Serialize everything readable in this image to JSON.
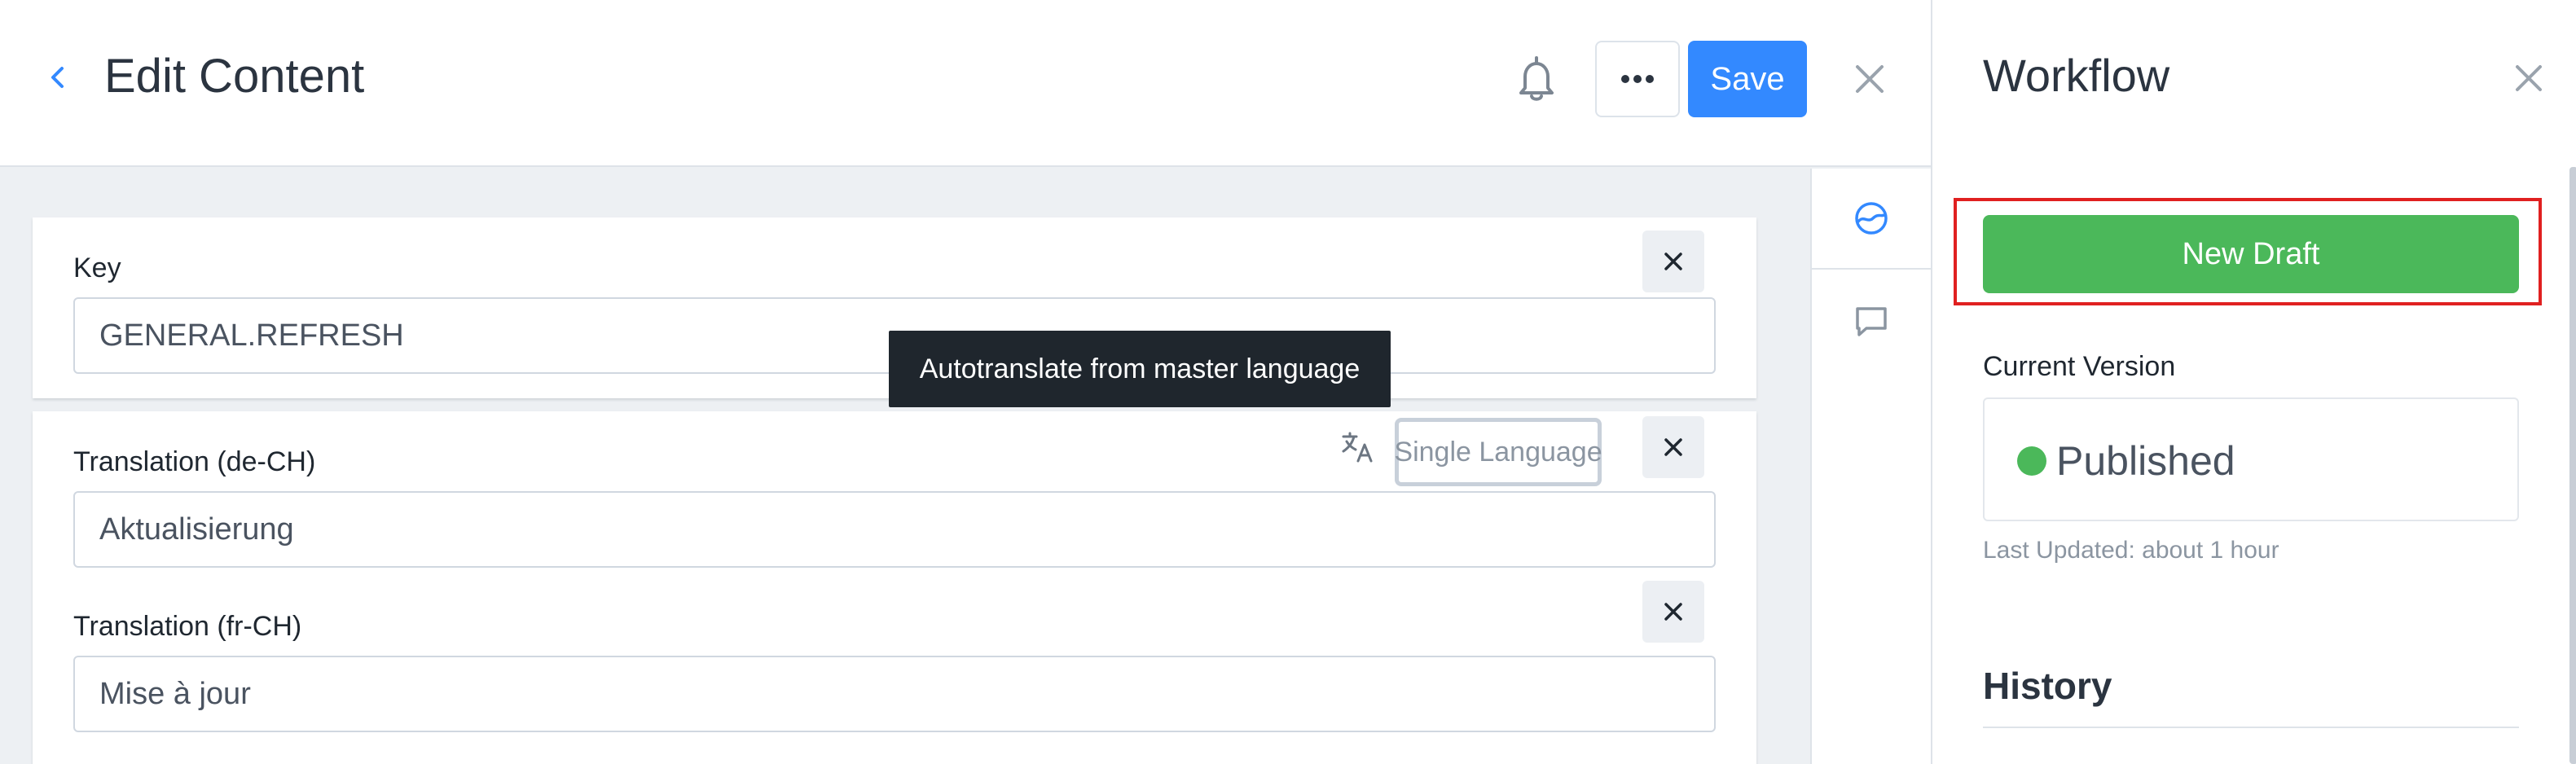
{
  "header": {
    "title": "Edit Content",
    "save_label": "Save",
    "icons": {
      "back": "chevron-left-icon",
      "bell": "bell-icon",
      "more": "more-horizontal-icon",
      "close": "close-icon"
    }
  },
  "fields": {
    "key": {
      "label": "Key",
      "value": "GENERAL.REFRESH"
    },
    "translations": [
      {
        "label": "Translation (de-CH)",
        "value": "Aktualisierung"
      },
      {
        "label": "Translation (fr-CH)",
        "value": "Mise à jour"
      }
    ],
    "single_language_label": "Single Language",
    "tooltip": "Autotranslate from master language"
  },
  "side_tabs": [
    {
      "icon": "history-icon",
      "active": true
    },
    {
      "icon": "comments-icon",
      "active": false
    }
  ],
  "workflow": {
    "title": "Workflow",
    "new_draft_label": "New Draft",
    "current_version_label": "Current Version",
    "status": "Published",
    "status_color": "#4bb85a",
    "last_updated": "Last Updated: about 1 hour",
    "history_title": "History"
  },
  "colors": {
    "accent": "#3389ff",
    "success": "#4bb85a",
    "highlight": "#e02020",
    "tooltip_bg": "#1f262d"
  }
}
